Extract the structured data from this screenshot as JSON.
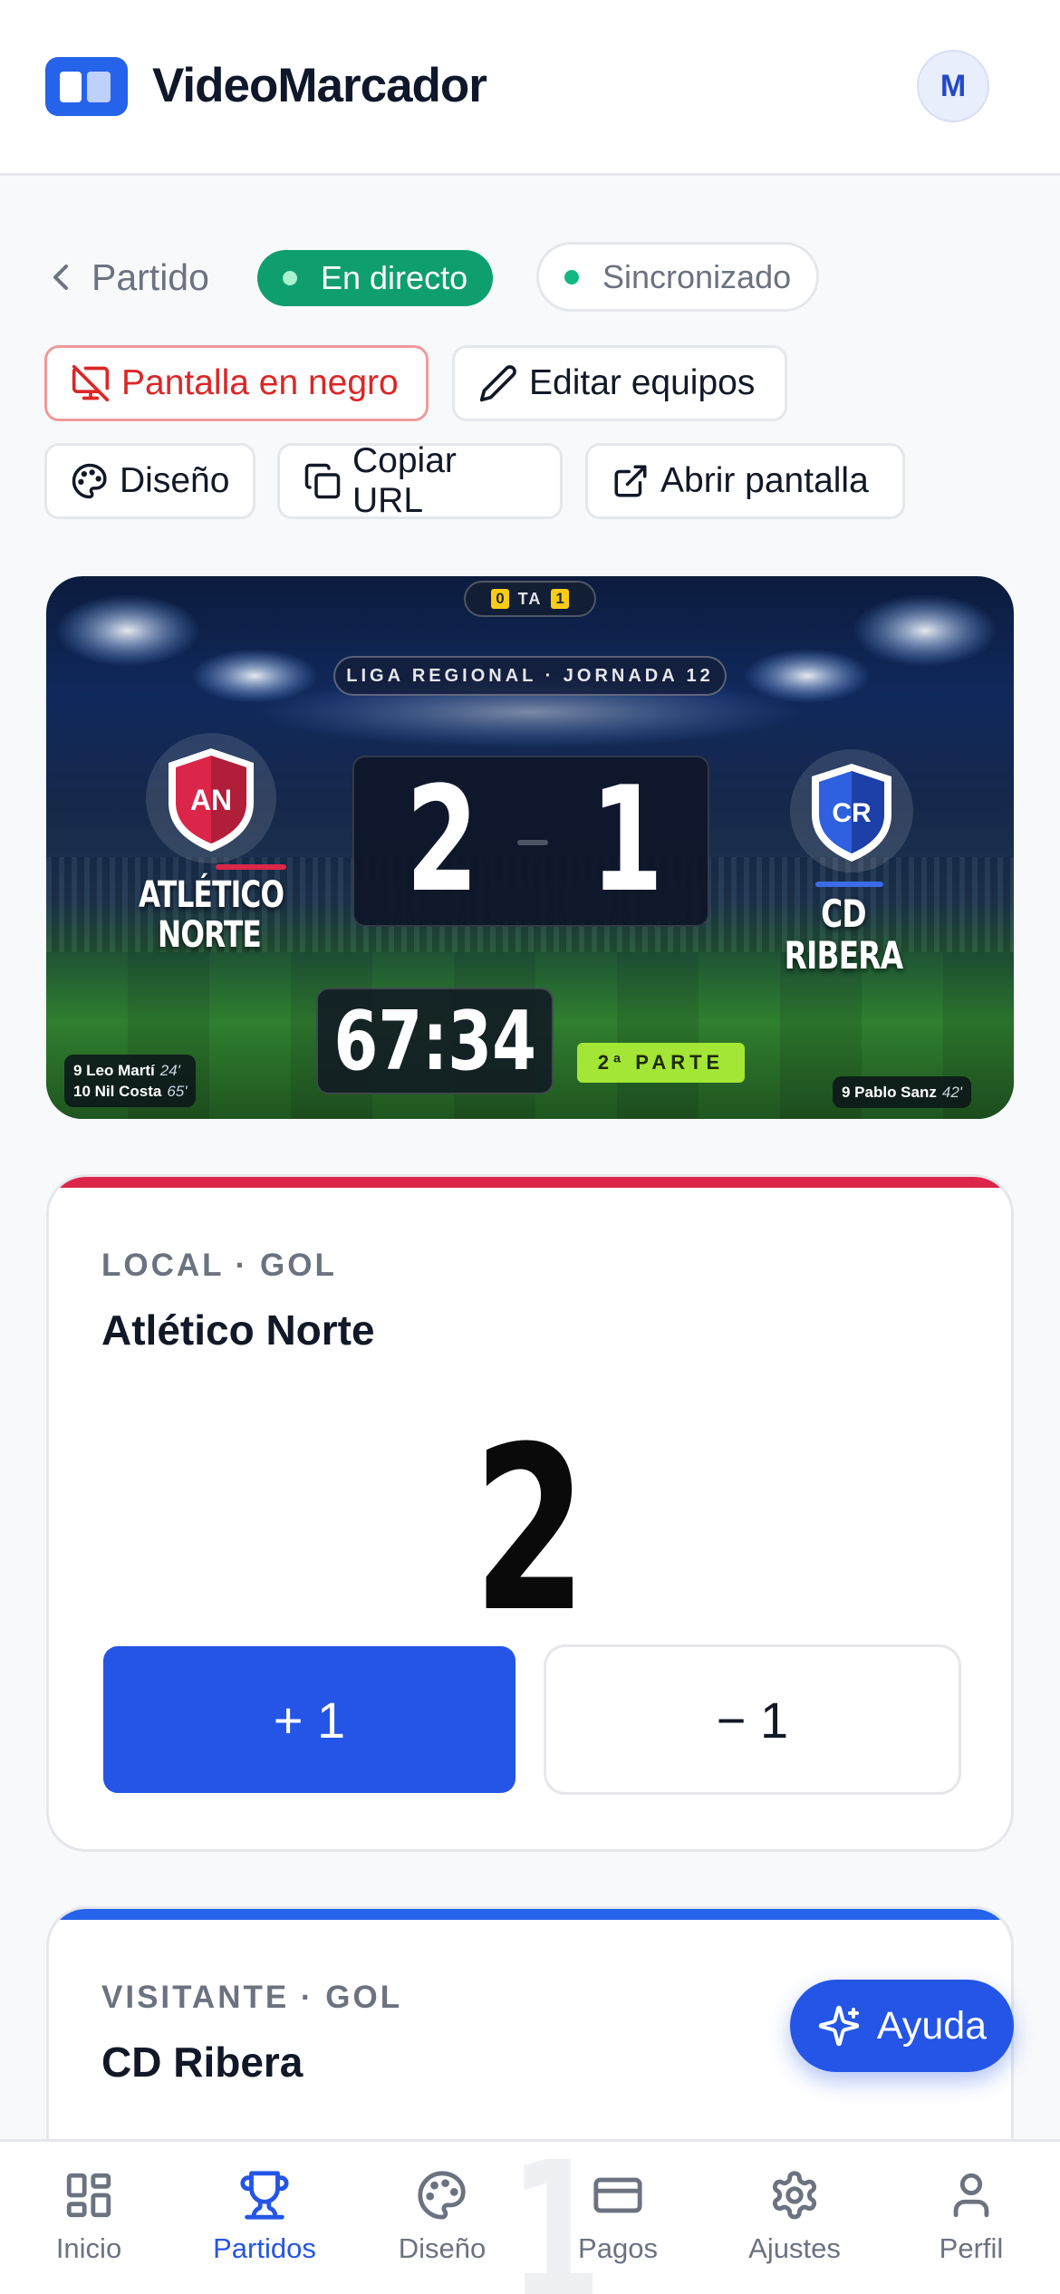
{
  "header": {
    "app_title": "VideoMarcador",
    "avatar_initial": "M"
  },
  "toolbar": {
    "back_label": "Partido",
    "live_label": "En directo",
    "sync_label": "Sincronizado",
    "black_screen_label": "Pantalla en negro",
    "edit_teams_label": "Editar equipos",
    "design_label": "Diseño",
    "copy_url_label": "Copiar URL",
    "open_screen_label": "Abrir pantalla"
  },
  "scoreboard": {
    "timeouts": {
      "home": "0",
      "label": "TA",
      "away": "1"
    },
    "league": "LIGA REGIONAL · JORNADA 12",
    "home": {
      "abbr": "AN",
      "name_line1": "ATLÉTICO",
      "name_line2": "NORTE",
      "score": "2"
    },
    "away": {
      "abbr": "CR",
      "name": "CD RIBERA",
      "score": "1"
    },
    "clock": "67:34",
    "period": "2ª PARTE",
    "home_scorers": [
      {
        "player": "9 Leo Martí",
        "minute": "24'"
      },
      {
        "player": "10 Nil Costa",
        "minute": "65'"
      }
    ],
    "away_scorers": [
      {
        "player": "9 Pablo Sanz",
        "minute": "42'"
      }
    ]
  },
  "home_card": {
    "kicker": "LOCAL · GOL",
    "team": "Atlético Norte",
    "score": "2",
    "plus_label": "+ 1",
    "minus_label": "− 1"
  },
  "away_card": {
    "kicker": "VISITANTE · GOL",
    "team": "CD Ribera"
  },
  "help_label": "Ayuda",
  "bottom_nav": {
    "ghost_number": "1",
    "items": [
      {
        "label": "Inicio",
        "icon": "grid-icon"
      },
      {
        "label": "Partidos",
        "icon": "trophy-icon"
      },
      {
        "label": "Diseño",
        "icon": "palette-icon"
      },
      {
        "label": "Pagos",
        "icon": "card-icon"
      },
      {
        "label": "Ajustes",
        "icon": "gear-icon"
      },
      {
        "label": "Perfil",
        "icon": "user-icon"
      }
    ],
    "active": "Partidos"
  },
  "colors": {
    "accent": "#2455e6",
    "home": "#dc2649",
    "away": "#2563eb",
    "live": "#0f9f6e",
    "danger": "#dc2626"
  }
}
